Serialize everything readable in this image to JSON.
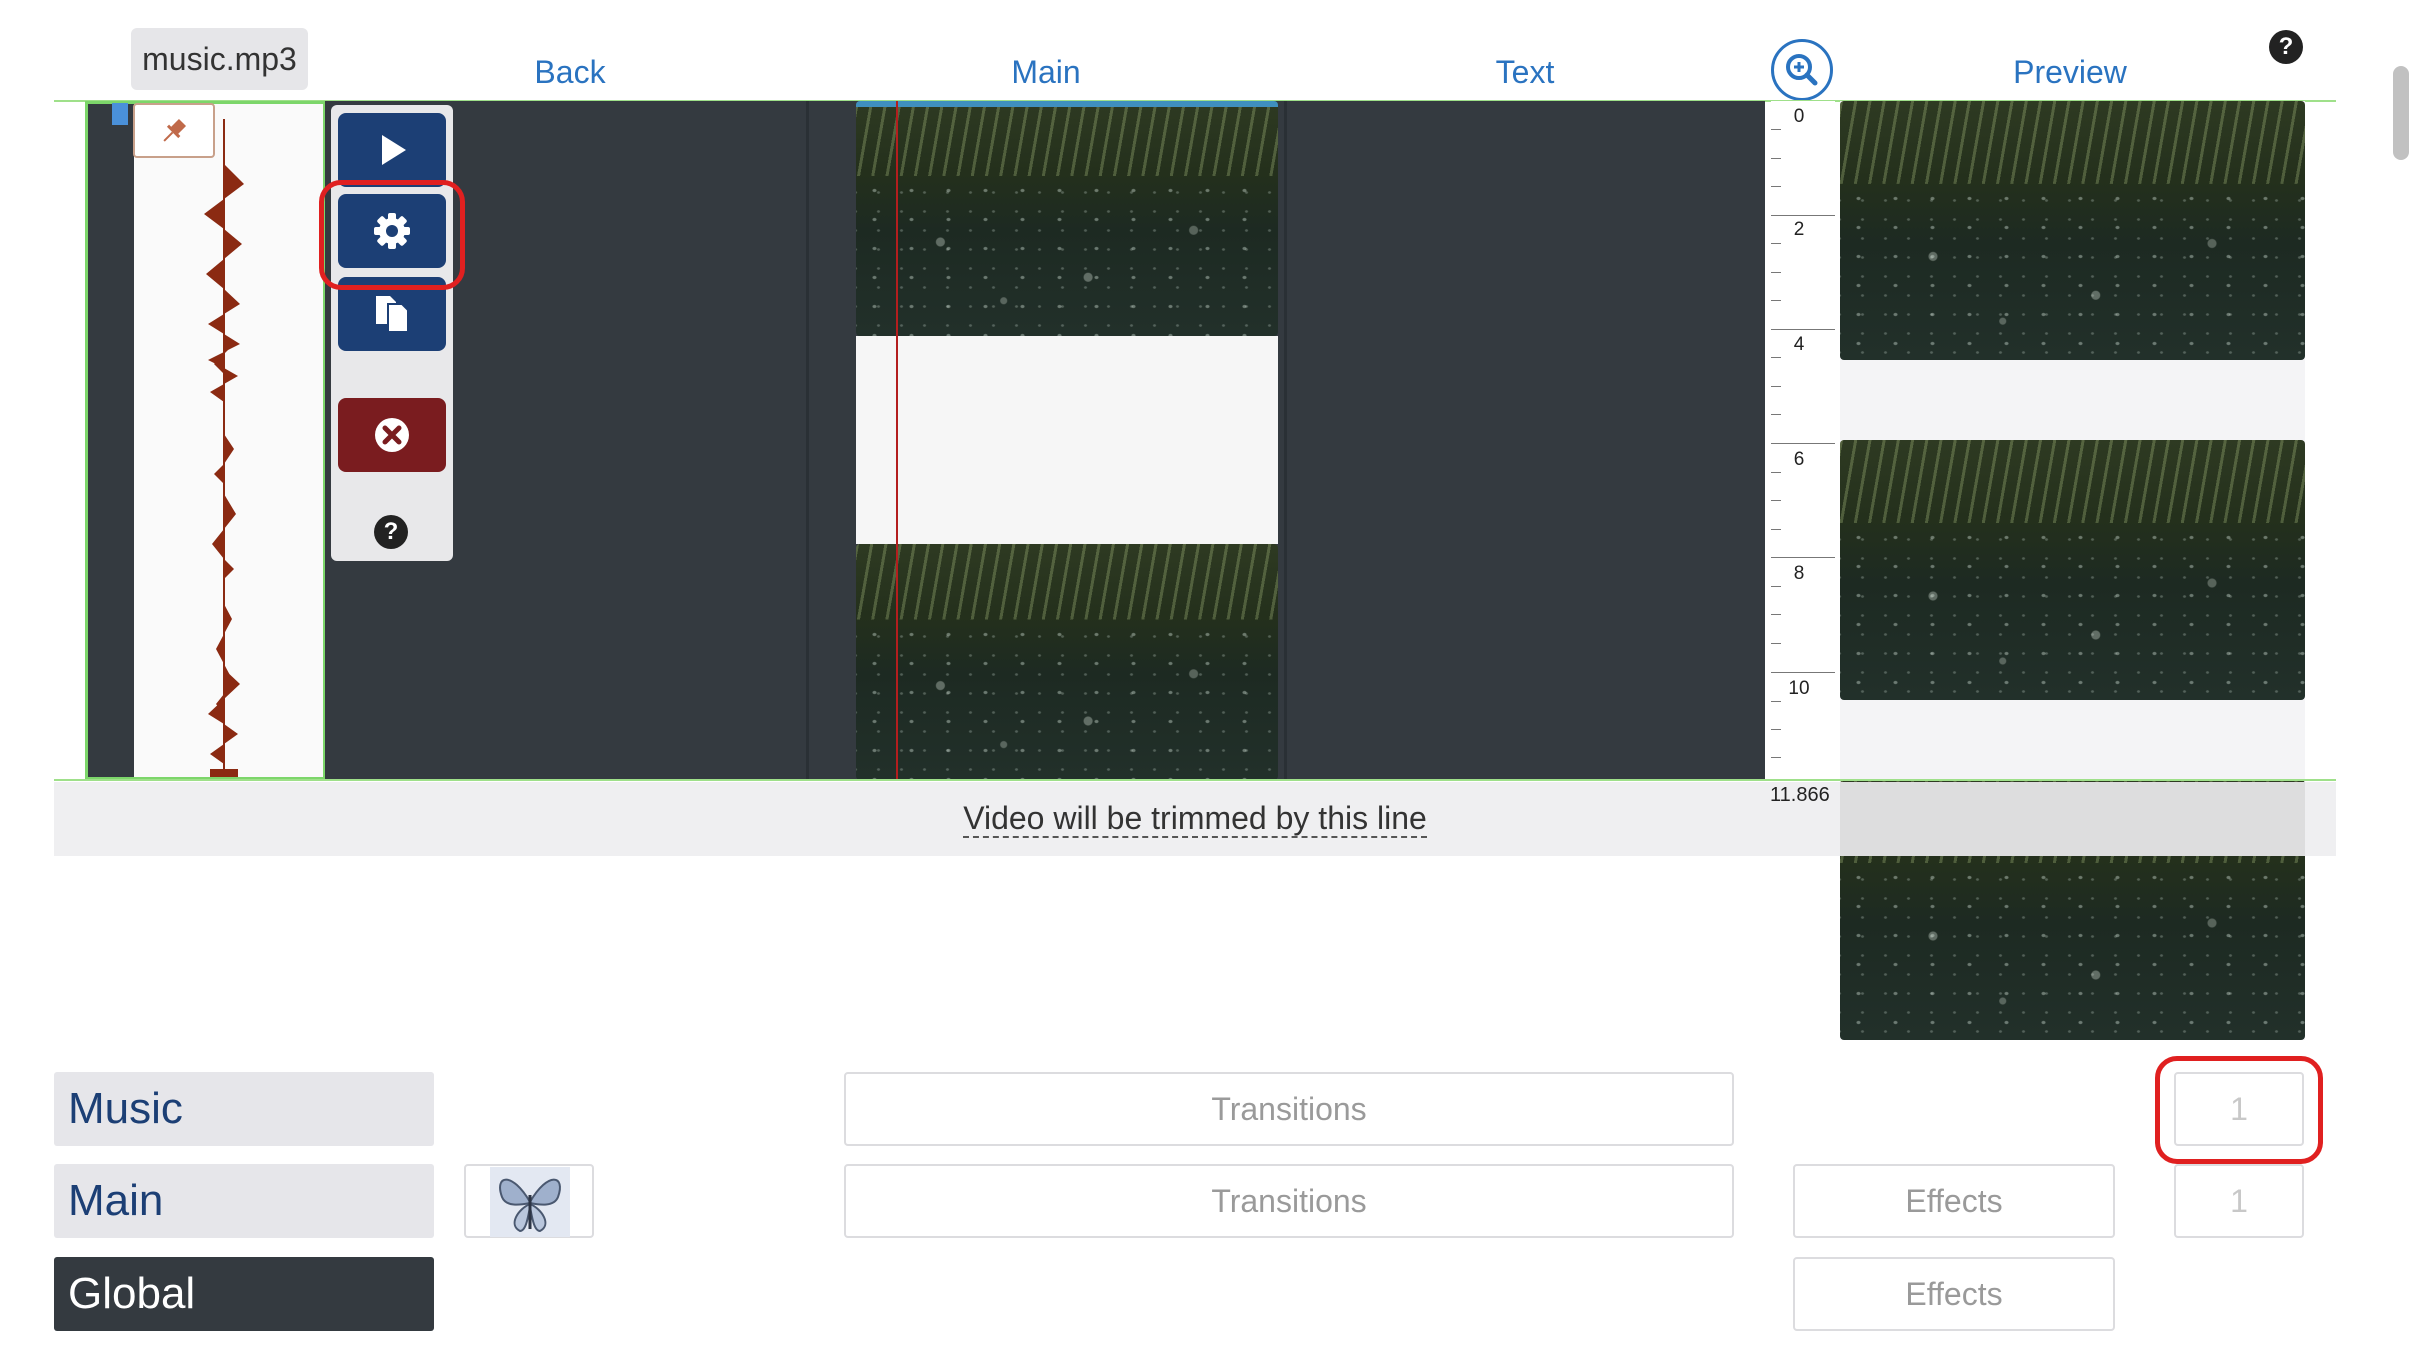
{
  "header": {
    "file_name": "music.mp3",
    "columns": {
      "back": "Back",
      "main": "Main",
      "text": "Text",
      "preview": "Preview"
    },
    "help_symbol": "?"
  },
  "toolbar": {
    "icons": [
      "play-icon",
      "gear-icon",
      "copy-files-icon",
      "delete-circle-icon",
      "help-circle-icon"
    ],
    "help_symbol": "?"
  },
  "ruler": {
    "marks": [
      "0",
      "2",
      "4",
      "6",
      "8",
      "10"
    ],
    "end_value": "11.866"
  },
  "trim_line": {
    "text": "Video will be trimmed by this line"
  },
  "rows": {
    "music": {
      "label": "Music",
      "transitions_label": "Transitions",
      "count_placeholder": "1"
    },
    "main": {
      "label": "Main",
      "transitions_label": "Transitions",
      "effects_label": "Effects",
      "count_placeholder": "1"
    },
    "global": {
      "label": "Global",
      "effects_label": "Effects"
    }
  },
  "colors": {
    "accent_blue": "#2a73c0",
    "dark_button": "#1c3f75",
    "delete_button": "#7a1c1f",
    "highlight_red": "#e02020",
    "timeline_dark": "#343a40",
    "waveform": "#8b2a12"
  }
}
